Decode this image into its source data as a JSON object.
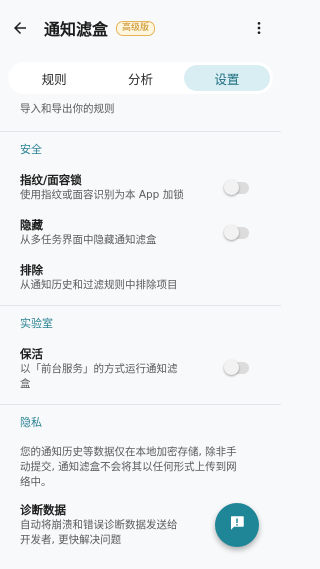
{
  "appbar": {
    "title": "通知滤盒",
    "badge": "高级版"
  },
  "tabs": [
    {
      "label": "规则",
      "active": false
    },
    {
      "label": "分析",
      "active": false
    },
    {
      "label": "设置",
      "active": true
    }
  ],
  "settings": {
    "import_export_subtitle": "导入和导出你的规则",
    "sections": {
      "security": "安全",
      "lab": "实验室",
      "privacy": "隐私"
    },
    "biometric": {
      "title": "指纹/面容锁",
      "subtitle": "使用指纹或面容识别为本 App 加锁",
      "enabled": false
    },
    "hide": {
      "title": "隐藏",
      "subtitle": "从多任务界面中隐藏通知滤盒",
      "enabled": false
    },
    "exclude": {
      "title": "排除",
      "subtitle": "从通知历史和过滤规则中排除项目"
    },
    "keepalive": {
      "title": "保活",
      "subtitle_line1": "以「前台服务」的方式运行通知滤",
      "subtitle_line2": "盒",
      "enabled": false
    },
    "privacy_note": {
      "line1": "您的通知历史等数据仅在本地加密存储, 除非手",
      "line2": "动提交, 通知滤盒不会将其以任何形式上传到网",
      "line3": "络中。"
    },
    "diagnostics": {
      "title": "诊断数据",
      "subtitle_line1": "自动将崩溃和错误诊断数据发送给",
      "subtitle_line2": "开发者, 更快解决问题"
    }
  },
  "colors": {
    "accent": "#1f8697",
    "section": "#2b8294",
    "tab_active_bg": "#d9eef3",
    "badge": "#c98a18"
  }
}
